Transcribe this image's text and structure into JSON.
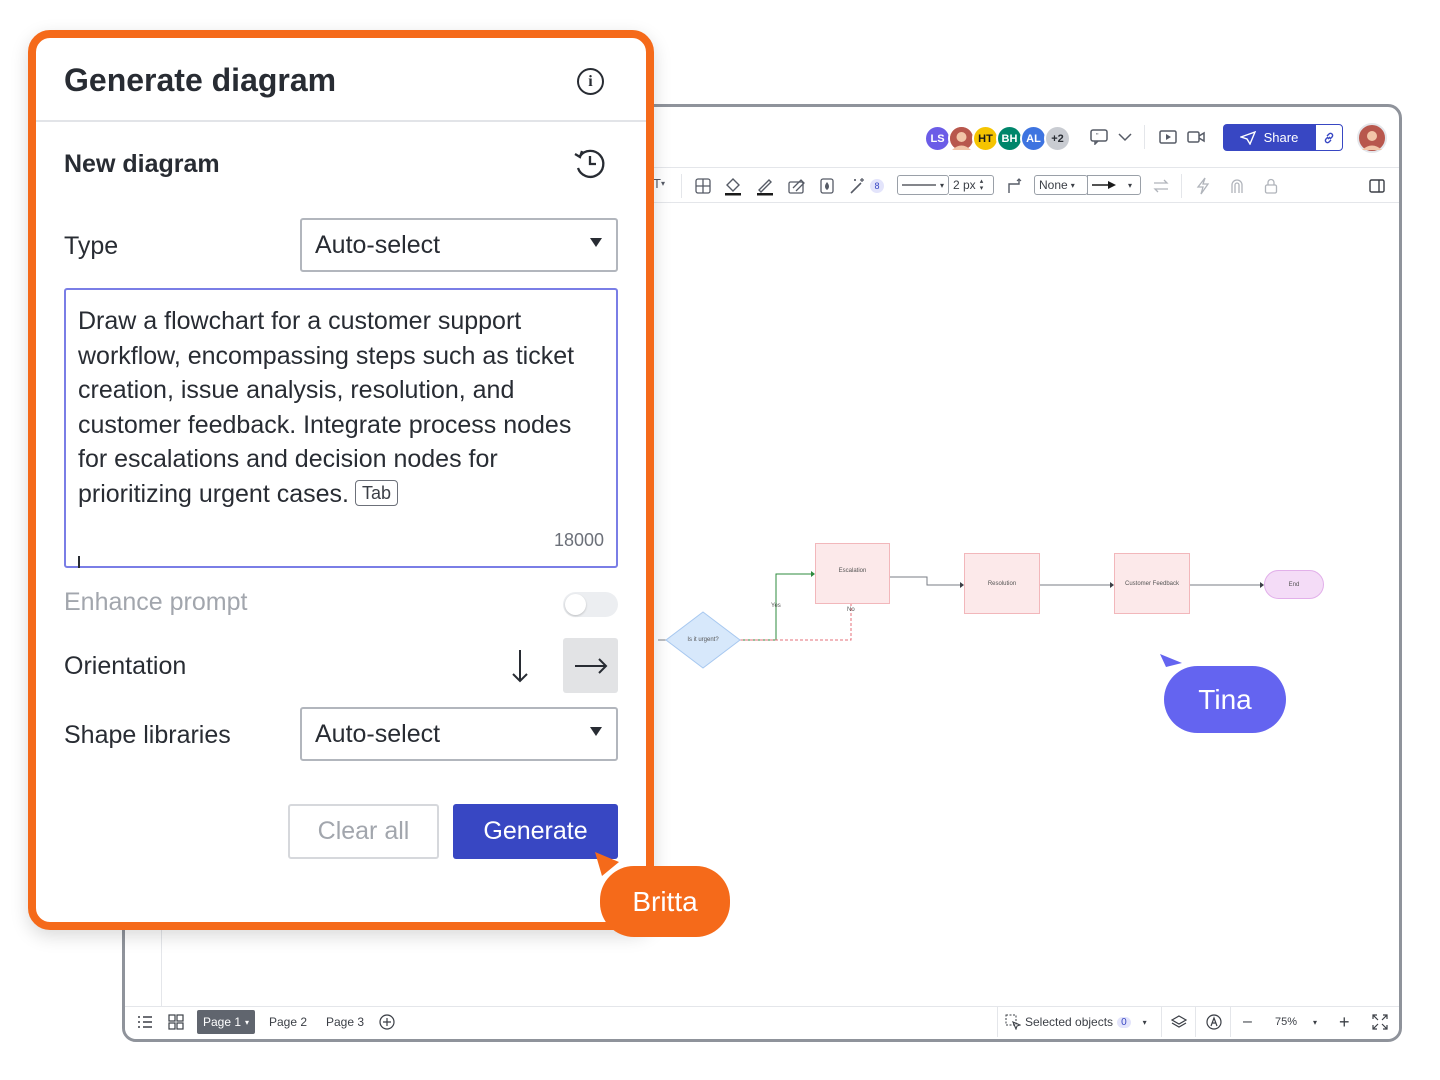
{
  "panel": {
    "title": "Generate diagram",
    "section_title": "New diagram",
    "type_label": "Type",
    "type_value": "Auto-select",
    "prompt_text": "Draw a flowchart for a customer support workflow, encompassing steps such as ticket creation, issue analysis, resolution, and customer feedback. Integrate process nodes for escalations and decision nodes for prioritizing urgent cases.",
    "tab_hint": "Tab",
    "char_count": "18000",
    "enhance_label": "Enhance prompt",
    "orientation_label": "Orientation",
    "shape_libraries_label": "Shape libraries",
    "shape_libraries_value": "Auto-select",
    "clear_label": "Clear all",
    "generate_label": "Generate"
  },
  "collaborators": {
    "avatars": [
      {
        "initials": "LS",
        "color": "#6b5ce7"
      },
      {
        "initials": "HT",
        "color": "#f5c400"
      },
      {
        "initials": "BH",
        "color": "#00866b"
      },
      {
        "initials": "AL",
        "color": "#3e74e0"
      }
    ],
    "overflow": "+2",
    "share_label": "Share"
  },
  "toolbar": {
    "text_tool": "T",
    "badge_count": "8",
    "line_width": "2 px",
    "arrow_start": "None"
  },
  "diagram": {
    "decision_label": "Is it urgent?",
    "yes_label": "Yes",
    "no_label": "No",
    "escalation": "Escalation",
    "resolution": "Resolution",
    "customer_feedback": "Customer Feedback",
    "end": "End"
  },
  "bottombar": {
    "pages": [
      "Page 1",
      "Page 2",
      "Page 3"
    ],
    "selected_label": "Selected objects",
    "selected_count": "0",
    "zoom": "75%"
  },
  "cursors": {
    "tina": "Tina",
    "britta": "Britta"
  },
  "colors": {
    "accent_orange": "#f56a1a",
    "primary_blue": "#3847c3",
    "tina_purple": "#6464f0"
  }
}
